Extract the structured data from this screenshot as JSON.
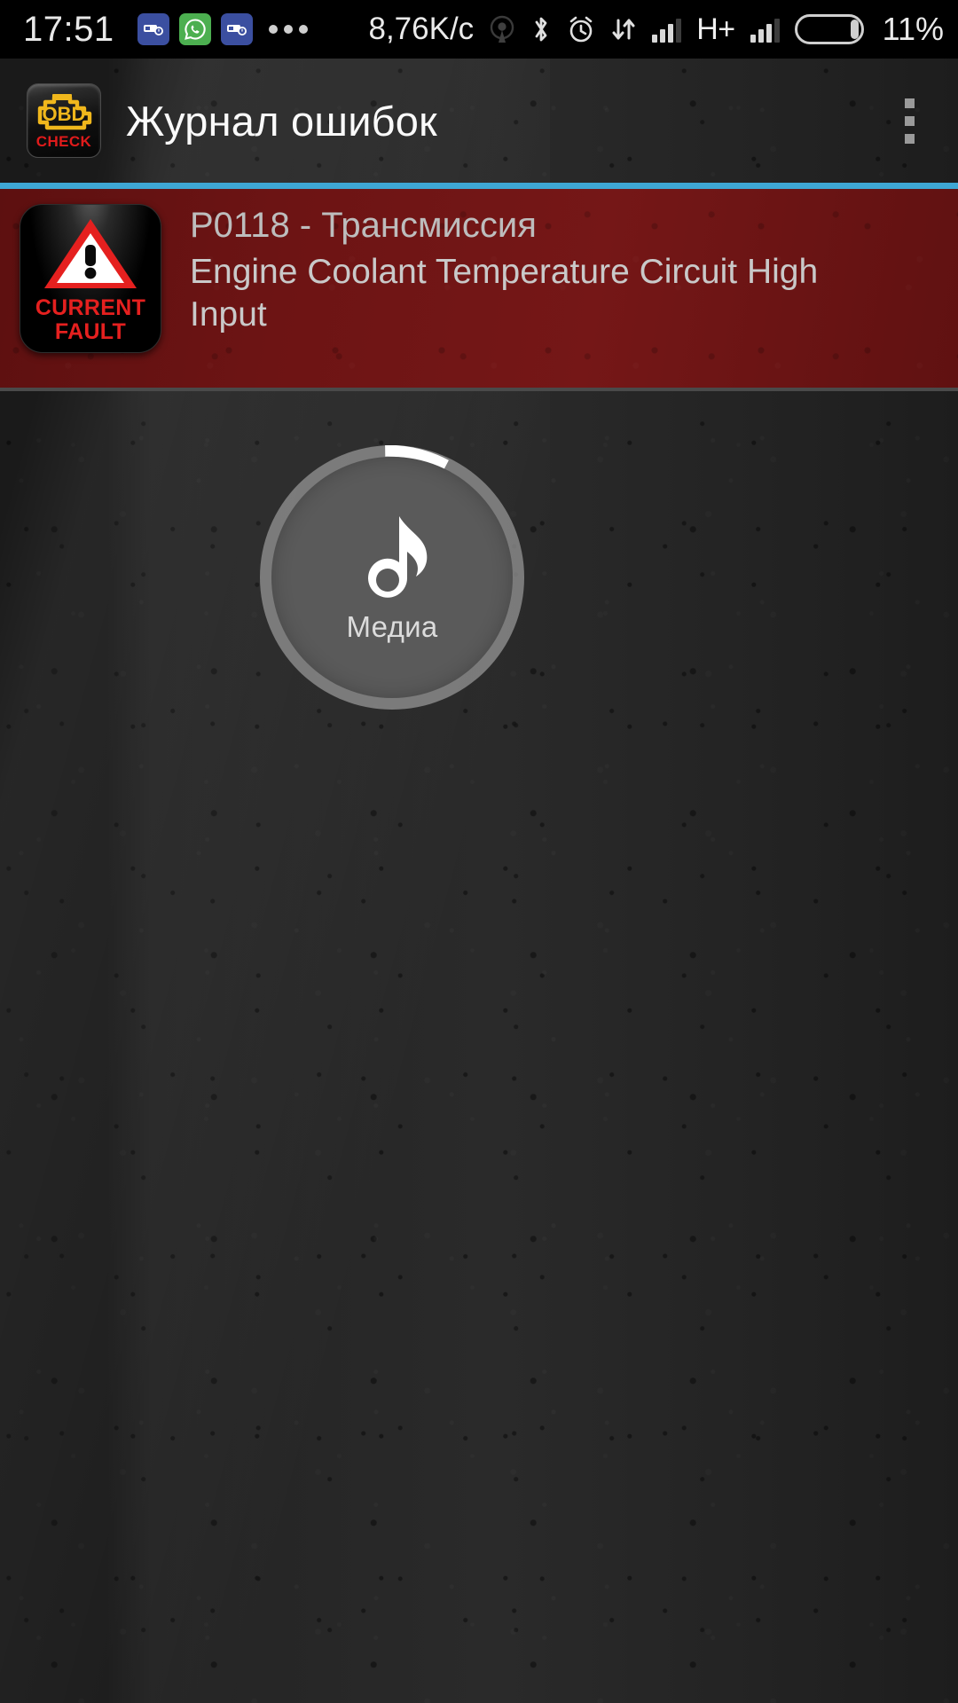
{
  "statusbar": {
    "time": "17:51",
    "network_speed": "8,76K/c",
    "network_type": "H+",
    "battery_percent": "11%",
    "battery_level": 11,
    "notification_icons": [
      {
        "name": "car-alert-icon",
        "color": "#3b4fa0"
      },
      {
        "name": "whatsapp-icon",
        "color": "#4caf50"
      },
      {
        "name": "car-alert-icon-2",
        "color": "#3b4fa0"
      }
    ],
    "more_icon": "overflow-dots-icon",
    "signal_icons": [
      "cast-icon",
      "bluetooth-icon",
      "alarm-icon",
      "data-transfer-icon"
    ],
    "colors": {
      "text": "#eaeaea",
      "background": "#000000"
    }
  },
  "appbar": {
    "title": "Журнал ошибок",
    "logo": {
      "top_text": "OBD",
      "bottom_text": "CHECK",
      "accent": "#f0b71c",
      "check_color": "#e01b1b"
    },
    "overflow_menu": "menu-overflow",
    "divider_color": "#3ea7d4"
  },
  "fault": {
    "badge_line1": "CURRENT",
    "badge_line2": "FAULT",
    "code": "P0118 - Трансмиссия",
    "description": "Engine Coolant Temperature Circuit High Input",
    "background_color": "#6d1414",
    "badge_color": "#e5201f"
  },
  "media_widget": {
    "label": "Медиа",
    "icon": "music-note-icon",
    "arc_start_deg": -3,
    "arc_sweep_deg": 25,
    "ring_color": "#9a9a9a",
    "fill_color": "#5a5a5a",
    "arc_color": "#ffffff"
  }
}
